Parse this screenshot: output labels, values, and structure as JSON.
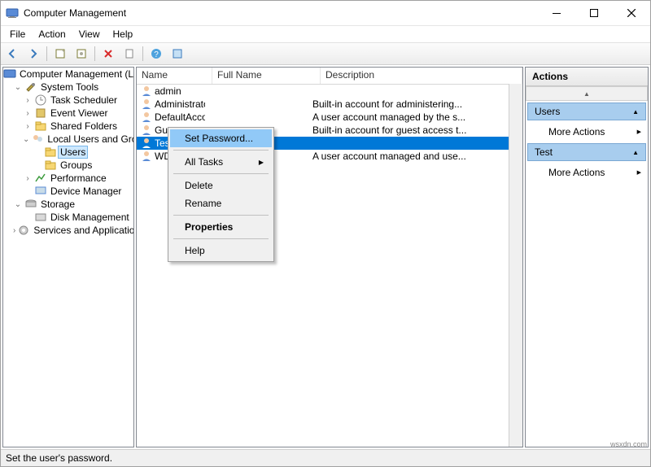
{
  "window": {
    "title": "Computer Management"
  },
  "menubar": [
    "File",
    "Action",
    "View",
    "Help"
  ],
  "tree": {
    "root": "Computer Management (Local",
    "nodes": [
      {
        "label": "System Tools",
        "open": true,
        "children": [
          {
            "label": "Task Scheduler"
          },
          {
            "label": "Event Viewer"
          },
          {
            "label": "Shared Folders"
          },
          {
            "label": "Local Users and Groups",
            "open": true,
            "children": [
              {
                "label": "Users",
                "selected": true
              },
              {
                "label": "Groups"
              }
            ]
          },
          {
            "label": "Performance"
          },
          {
            "label": "Device Manager"
          }
        ]
      },
      {
        "label": "Storage",
        "open": true,
        "children": [
          {
            "label": "Disk Management"
          }
        ]
      },
      {
        "label": "Services and Applications"
      }
    ]
  },
  "list": {
    "columns": {
      "name": "Name",
      "fullname": "Full Name",
      "description": "Description"
    },
    "rows": [
      {
        "name": "admin",
        "fullname": "",
        "description": ""
      },
      {
        "name": "Administrator",
        "fullname": "",
        "description": "Built-in account for administering..."
      },
      {
        "name": "DefaultAcco",
        "fullname": "",
        "description": "A user account managed by the s..."
      },
      {
        "name": "Guest",
        "fullname": "",
        "description": "Built-in account for guest access t..."
      },
      {
        "name": "Test",
        "fullname": "",
        "description": "",
        "selected": true
      },
      {
        "name": "WD",
        "fullname": "",
        "description": "A user account managed and use..."
      }
    ]
  },
  "context_menu": {
    "items": [
      {
        "label": "Set Password...",
        "highlight": true
      },
      {
        "sep": true
      },
      {
        "label": "All Tasks",
        "submenu": true
      },
      {
        "sep": true
      },
      {
        "label": "Delete"
      },
      {
        "label": "Rename"
      },
      {
        "sep": true
      },
      {
        "label": "Properties",
        "bold": true
      },
      {
        "sep": true
      },
      {
        "label": "Help"
      }
    ]
  },
  "actions": {
    "header": "Actions",
    "sections": [
      {
        "title": "Users",
        "items": [
          "More Actions"
        ]
      },
      {
        "title": "Test",
        "items": [
          "More Actions"
        ]
      }
    ]
  },
  "status": "Set the user's password.",
  "watermark": "wsxdn.com"
}
